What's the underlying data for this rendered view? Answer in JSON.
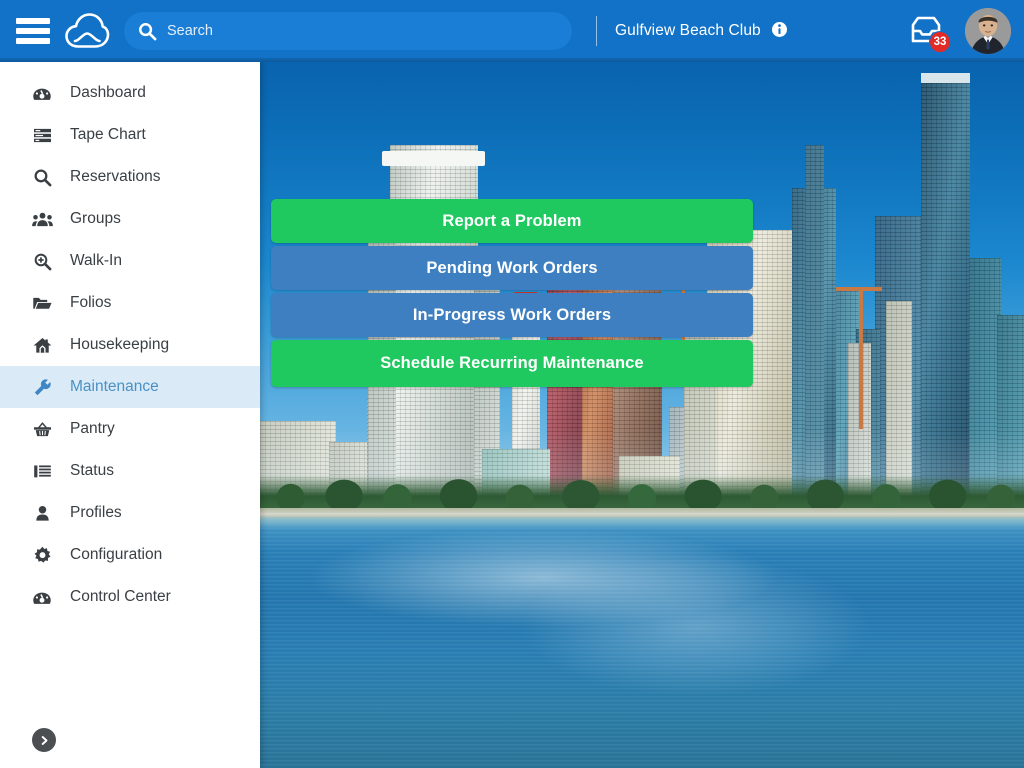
{
  "header": {
    "menu_icon": "hamburger-menu-icon",
    "logo_icon": "cloud-logo-icon",
    "search": {
      "icon": "search-icon",
      "placeholder": "Search",
      "value": ""
    },
    "property_name": "Gulfview Beach Club",
    "property_info_icon": "info-circle-icon",
    "inbox_icon": "inbox-icon",
    "inbox_badge_count": "33",
    "avatar_icon": "user-avatar",
    "bar_color": "#1272c8"
  },
  "sidebar": {
    "collapse_icon": "chevron-right-circle-icon",
    "active_item": "Maintenance",
    "active_bg_color": "#daeaf7",
    "active_text_color": "#4a90c4",
    "items": [
      {
        "label": "Dashboard",
        "icon": "dashboard-gauge-icon"
      },
      {
        "label": "Tape Chart",
        "icon": "tape-chart-rows-icon"
      },
      {
        "label": "Reservations",
        "icon": "search-magnifier-icon"
      },
      {
        "label": "Groups",
        "icon": "users-group-icon"
      },
      {
        "label": "Walk-In",
        "icon": "magnifier-plus-icon"
      },
      {
        "label": "Folios",
        "icon": "folder-open-icon"
      },
      {
        "label": "Housekeeping",
        "icon": "home-icon"
      },
      {
        "label": "Maintenance",
        "icon": "wrench-icon"
      },
      {
        "label": "Pantry",
        "icon": "basket-icon"
      },
      {
        "label": "Status",
        "icon": "list-lines-icon"
      },
      {
        "label": "Profiles",
        "icon": "person-icon"
      },
      {
        "label": "Configuration",
        "icon": "gear-icon"
      },
      {
        "label": "Control Center",
        "icon": "dashboard-gauge-icon"
      }
    ]
  },
  "main": {
    "background_image": "city-skyline-waterfront-photo",
    "actions": [
      {
        "label": "Report a Problem",
        "style": "green",
        "color": "#1fc960"
      },
      {
        "label": "Pending Work Orders",
        "style": "blue",
        "color": "#3e7fc1"
      },
      {
        "label": "In-Progress Work Orders",
        "style": "blue",
        "color": "#3e7fc1"
      },
      {
        "label": "Schedule Recurring Maintenance",
        "style": "green",
        "color": "#1fc960"
      }
    ]
  }
}
